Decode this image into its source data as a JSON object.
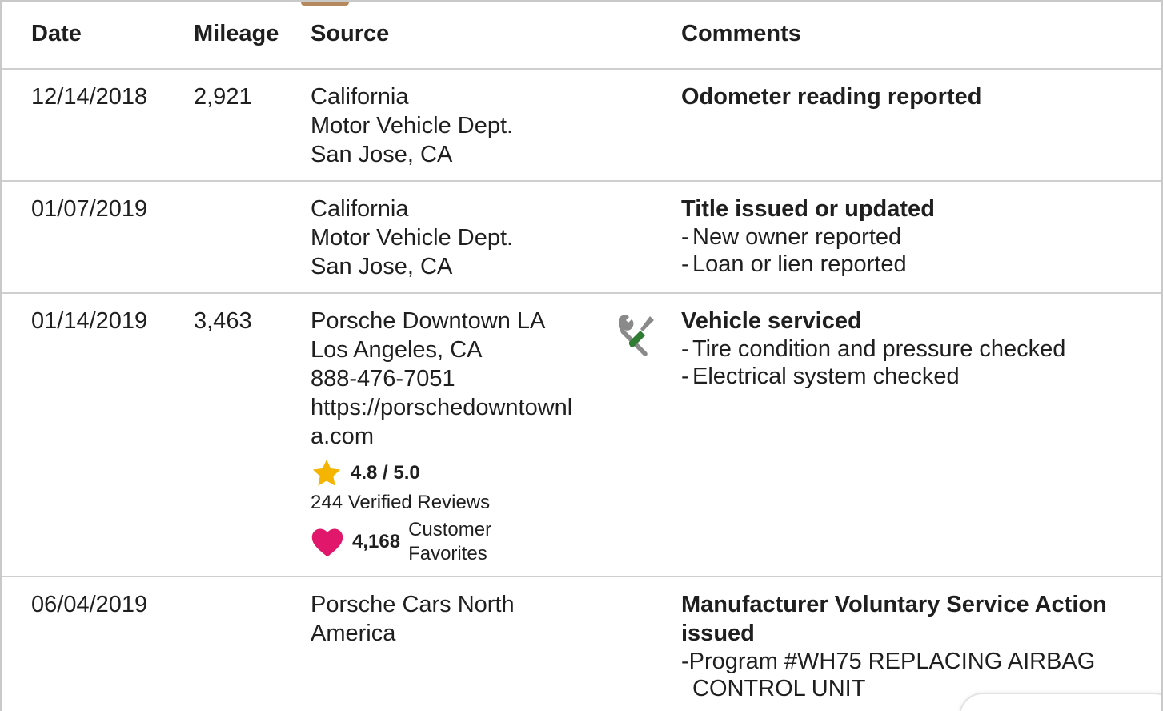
{
  "header": {
    "date": "Date",
    "mileage": "Mileage",
    "source": "Source",
    "comments": "Comments"
  },
  "rows": [
    {
      "date": "12/14/2018",
      "mileage": "2,921",
      "source": [
        "California",
        "Motor Vehicle Dept.",
        "San Jose, CA"
      ],
      "comment_title": "Odometer reading reported",
      "comment_items": []
    },
    {
      "date": "01/07/2019",
      "mileage": "",
      "source": [
        "California",
        "Motor Vehicle Dept.",
        "San Jose, CA"
      ],
      "comment_title": "Title issued or updated",
      "comment_items": [
        "New owner reported",
        "Loan or lien reported"
      ]
    },
    {
      "date": "01/14/2019",
      "mileage": "3,463",
      "source": [
        "Porsche Downtown LA",
        "Los Angeles, CA",
        "888-476-7051",
        "https://porschedowntownla.com"
      ],
      "rating": "4.8 / 5.0",
      "rating_stars": 4.8,
      "reviews": "244 Verified Reviews",
      "favorites_count": "4,168",
      "favorites_label": "Customer Favorites",
      "icon": "wrench-screwdriver-icon",
      "comment_title": "Vehicle serviced",
      "comment_items": [
        "Tire condition and pressure checked",
        "Electrical system checked"
      ]
    },
    {
      "date": "06/04/2019",
      "mileage": "",
      "source": [
        "Porsche Cars North America"
      ],
      "comment_title": "Manufacturer Voluntary Service Action issued",
      "comment_items": [
        "Program #WH75 REPLACING AIRBAG CONTROL UNIT"
      ]
    }
  ],
  "colors": {
    "star": "#f5b400",
    "heart": "#e0176a",
    "wrench": "#8a8a8a",
    "screwdriver": "#2e7d32",
    "divider": "#cfcfcf"
  }
}
